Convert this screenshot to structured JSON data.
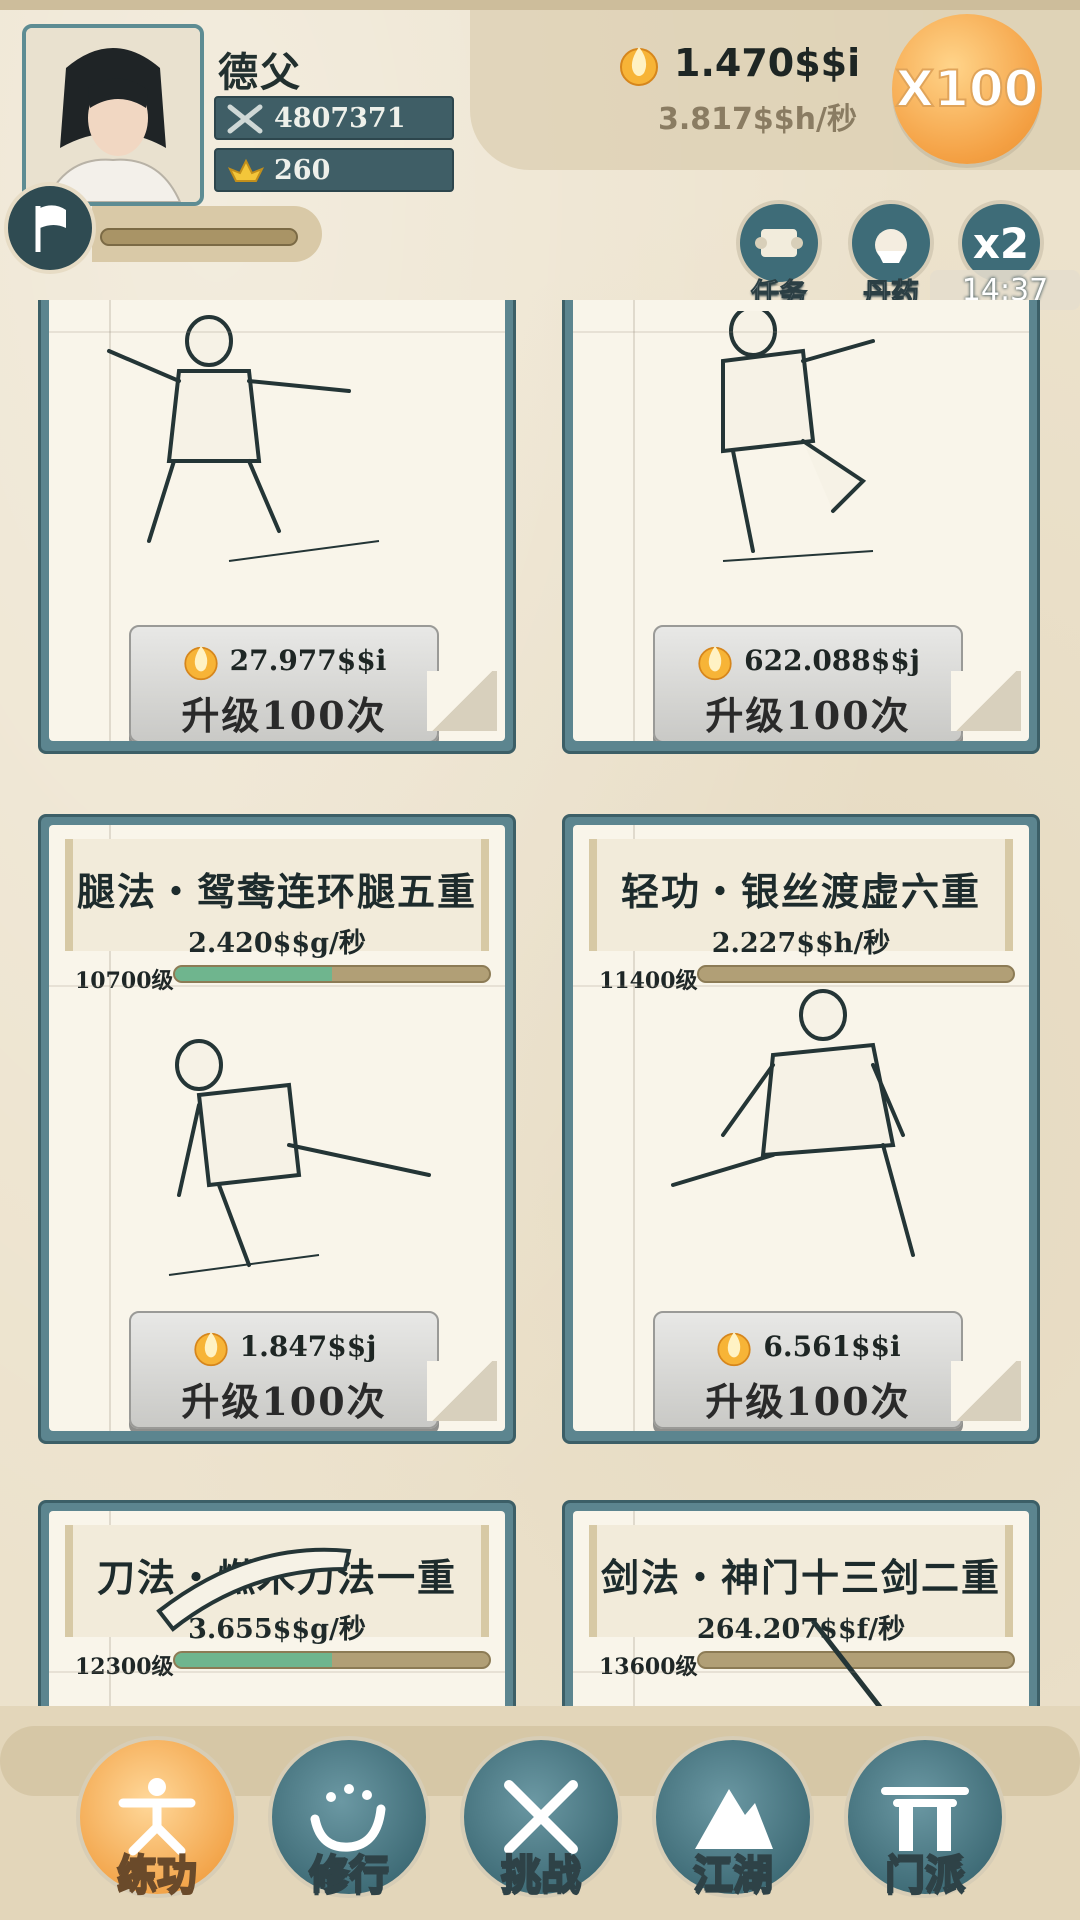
{
  "player": {
    "name": "德父",
    "power": "4807371",
    "gold": "260"
  },
  "currency": {
    "amount": "1.470$$i",
    "rate": "3.817$$h/秒"
  },
  "boost": {
    "multiplier_label": "X100"
  },
  "quick_buttons": {
    "task_label": "任务",
    "pill_label": "丹药",
    "x2_label": "x2",
    "timer": "14:37"
  },
  "cards": [
    {
      "title": "",
      "rate": "",
      "level": "",
      "level_progress": null,
      "cost": "27.977$$i",
      "upgrade_label": "升级100次"
    },
    {
      "title": "",
      "rate": "",
      "level": "",
      "level_progress": null,
      "cost": "622.088$$j",
      "upgrade_label": "升级100次"
    },
    {
      "title": "腿法・鸳鸯连环腿五重",
      "rate": "2.420$$g/秒",
      "level": "10700级",
      "level_progress": 0.5,
      "cost": "1.847$$j",
      "upgrade_label": "升级100次"
    },
    {
      "title": "轻功・银丝渡虚六重",
      "rate": "2.227$$h/秒",
      "level": "11400级",
      "level_progress": 0.0,
      "cost": "6.561$$i",
      "upgrade_label": "升级100次"
    },
    {
      "title": "刀法・燃木刀法一重",
      "rate": "3.655$$g/秒",
      "level": "12300级",
      "level_progress": 0.5,
      "cost": "",
      "upgrade_label": ""
    },
    {
      "title": "剑法・神门十三剑二重",
      "rate": "264.207$$f/秒",
      "level": "13600级",
      "level_progress": 0.0,
      "cost": "",
      "upgrade_label": ""
    }
  ],
  "bottom_nav": [
    {
      "label": "练功",
      "icon": "kungfu-icon",
      "active": true
    },
    {
      "label": "修行",
      "icon": "heart-icon",
      "active": false
    },
    {
      "label": "挑战",
      "icon": "crossed-swords-icon",
      "active": false
    },
    {
      "label": "江湖",
      "icon": "mountain-icon",
      "active": false
    },
    {
      "label": "门派",
      "icon": "gate-icon",
      "active": false
    }
  ],
  "colors": {
    "accent_teal": "#3e6c78",
    "accent_orange": "#f2a348",
    "progress_green": "#6fb58e"
  }
}
